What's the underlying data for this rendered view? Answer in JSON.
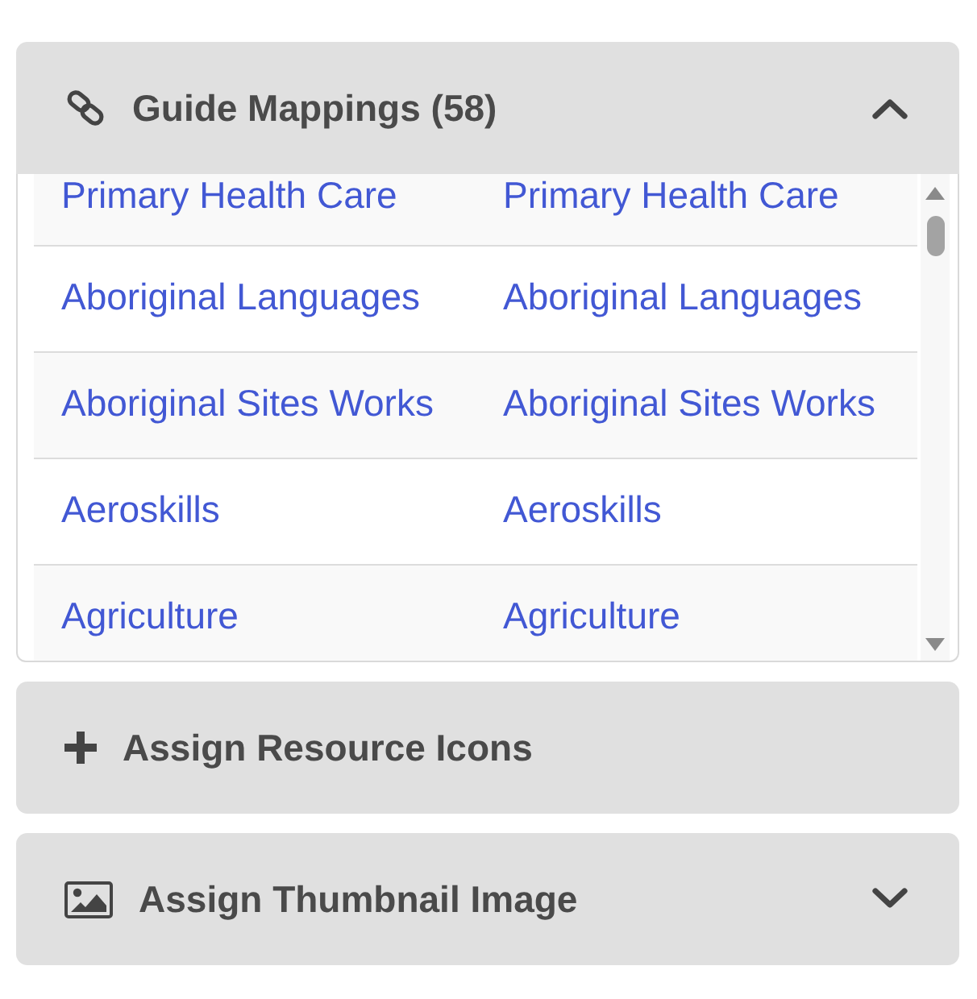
{
  "guide_mappings": {
    "title": "Guide Mappings (58)",
    "expanded": true,
    "rows": [
      {
        "cells": [
          "Primary Health Care",
          "Primary Health Care"
        ]
      },
      {
        "cells": [
          "Aboriginal Languages",
          "Aboriginal Languages"
        ]
      },
      {
        "cells": [
          "Aboriginal Sites Works",
          "Aboriginal Sites Works"
        ]
      },
      {
        "cells": [
          "Aeroskills",
          "Aeroskills"
        ]
      },
      {
        "cells": [
          "Agriculture",
          "Agriculture"
        ]
      }
    ]
  },
  "assign_resource_icons": {
    "title": "Assign Resource Icons"
  },
  "assign_thumbnail_image": {
    "title": "Assign Thumbnail Image",
    "expanded": false
  }
}
